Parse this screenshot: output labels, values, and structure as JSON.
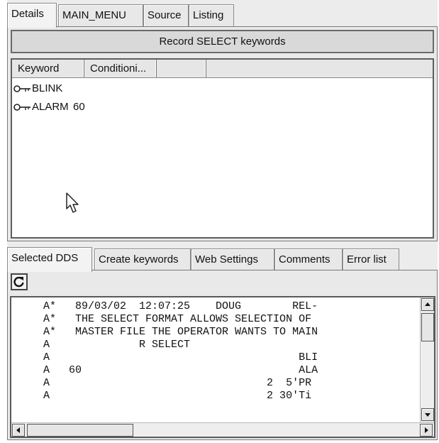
{
  "top_tabs": [
    "Details",
    "MAIN_MENU",
    "Source",
    "Listing"
  ],
  "record_bar": "Record SELECT keywords",
  "keyword_list": {
    "columns": [
      "Keyword",
      "Conditioni..."
    ],
    "rows": [
      {
        "keyword": "BLINK",
        "condition": ""
      },
      {
        "keyword": "ALARM",
        "condition": "60"
      }
    ]
  },
  "bottom_tabs": [
    "Selected DDS",
    "Create keywords",
    "Web Settings",
    "Comments",
    "Error list"
  ],
  "code_lines": [
    "     A*   89/03/02  12:07:25    DOUG        REL-",
    "     A*   THE SELECT FORMAT ALLOWS SELECTION OF",
    "     A*   MASTER FILE THE OPERATOR WANTS TO MAIN",
    "     A              R SELECT",
    "     A                                       BLI",
    "     A   60                                  ALA",
    "     A                                  2  5'PR",
    "     A                                  2 30'Ti"
  ],
  "icons": {
    "key": "key-icon",
    "refresh": "refresh-icon",
    "cursor": "mouse-cursor-icon"
  }
}
